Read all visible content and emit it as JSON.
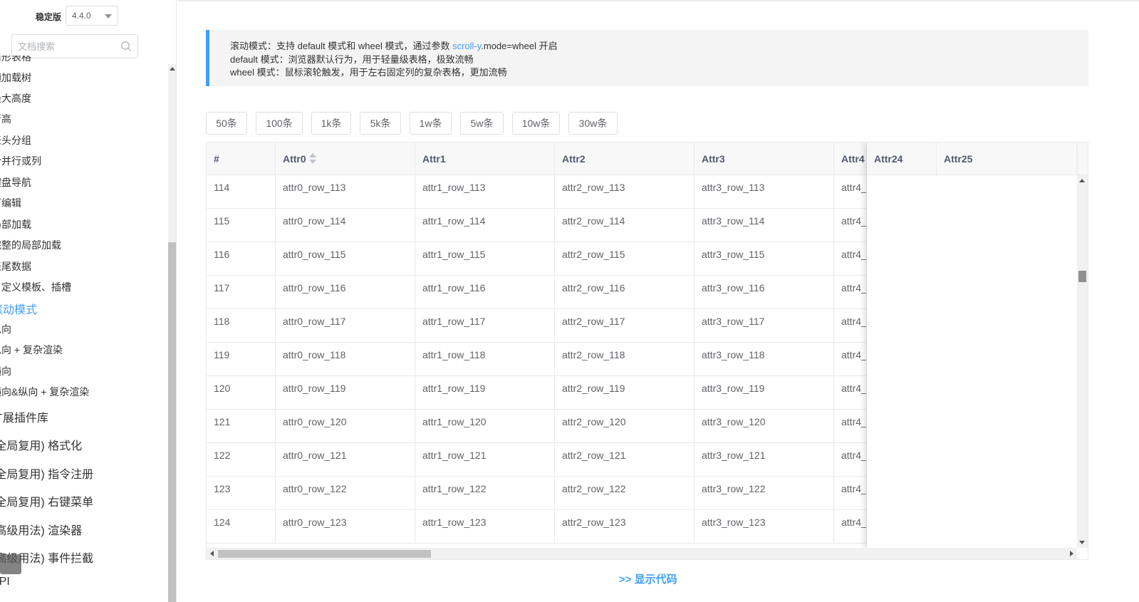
{
  "version": {
    "label": "稳定版",
    "value": "4.4.0"
  },
  "search": {
    "placeholder": "文档搜索"
  },
  "nav": {
    "items": [
      {
        "label": "树形表格",
        "kind": "sub"
      },
      {
        "label": "懒加载树",
        "kind": "sub"
      },
      {
        "label": "最大高度",
        "kind": "sub"
      },
      {
        "label": "行高",
        "kind": "sub"
      },
      {
        "label": "表头分组",
        "kind": "sub"
      },
      {
        "label": "合并行或列",
        "kind": "sub"
      },
      {
        "label": "键盘导航",
        "kind": "sub"
      },
      {
        "label": "可编辑",
        "kind": "sub"
      },
      {
        "label": "局部加载",
        "kind": "sub"
      },
      {
        "label": "完整的局部加载",
        "kind": "sub"
      },
      {
        "label": "表尾数据",
        "kind": "sub"
      },
      {
        "label": "自定义模板、插槽",
        "kind": "sub"
      },
      {
        "label": "滚动模式",
        "kind": "active"
      },
      {
        "label": "纵向",
        "kind": "sub"
      },
      {
        "label": "纵向 + 复杂渲染",
        "kind": "sub"
      },
      {
        "label": "横向",
        "kind": "sub"
      },
      {
        "label": "横向&纵向 + 复杂渲染",
        "kind": "sub"
      },
      {
        "label": "扩展插件库",
        "kind": "major"
      },
      {
        "label": "(全局复用) 格式化",
        "kind": "major"
      },
      {
        "label": "(全局复用) 指令注册",
        "kind": "major"
      },
      {
        "label": "(全局复用) 右键菜单",
        "kind": "major"
      },
      {
        "label": "(高级用法) 渲染器",
        "kind": "major"
      },
      {
        "label": "(高级用法) 事件拦截",
        "kind": "major"
      },
      {
        "label": "API",
        "kind": "major"
      }
    ]
  },
  "tip": {
    "line1_prefix": "滚动模式：支持 default 模式和 wheel 模式，通过参数 ",
    "line1_link": "scroll-y",
    "line1_suffix": ".mode=wheel 开启",
    "line2": "default 模式：浏览器默认行为，用于轻量级表格，极致流畅",
    "line3": "wheel 模式：鼠标滚轮触发，用于左右固定列的复杂表格，更加流畅"
  },
  "buttons": [
    "50条",
    "100条",
    "1k条",
    "5k条",
    "1w条",
    "5w条",
    "10w条",
    "30w条"
  ],
  "table": {
    "columns": [
      "#",
      "Attr0",
      "Attr1",
      "Attr2",
      "Attr3",
      "Attr4"
    ],
    "fixed_columns": [
      "Attr24",
      "Attr25"
    ],
    "rows": [
      [
        "114",
        "attr0_row_113",
        "attr1_row_113",
        "attr2_row_113",
        "attr3_row_113",
        "attr4_"
      ],
      [
        "115",
        "attr0_row_114",
        "attr1_row_114",
        "attr2_row_114",
        "attr3_row_114",
        "attr4_"
      ],
      [
        "116",
        "attr0_row_115",
        "attr1_row_115",
        "attr2_row_115",
        "attr3_row_115",
        "attr4_"
      ],
      [
        "117",
        "attr0_row_116",
        "attr1_row_116",
        "attr2_row_116",
        "attr3_row_116",
        "attr4_"
      ],
      [
        "118",
        "attr0_row_117",
        "attr1_row_117",
        "attr2_row_117",
        "attr3_row_117",
        "attr4_"
      ],
      [
        "119",
        "attr0_row_118",
        "attr1_row_118",
        "attr2_row_118",
        "attr3_row_118",
        "attr4_"
      ],
      [
        "120",
        "attr0_row_119",
        "attr1_row_119",
        "attr2_row_119",
        "attr3_row_119",
        "attr4_"
      ],
      [
        "121",
        "attr0_row_120",
        "attr1_row_120",
        "attr2_row_120",
        "attr3_row_120",
        "attr4_"
      ],
      [
        "122",
        "attr0_row_121",
        "attr1_row_121",
        "attr2_row_121",
        "attr3_row_121",
        "attr4_"
      ],
      [
        "123",
        "attr0_row_122",
        "attr1_row_122",
        "attr2_row_122",
        "attr3_row_122",
        "attr4_"
      ],
      [
        "124",
        "attr0_row_123",
        "attr1_row_123",
        "attr2_row_123",
        "attr3_row_123",
        "attr4_"
      ]
    ]
  },
  "show_code": ">> 显示代码",
  "colors": {
    "accent": "#409eff",
    "header_bg": "#f8f8f9",
    "border": "#e8eaec"
  }
}
